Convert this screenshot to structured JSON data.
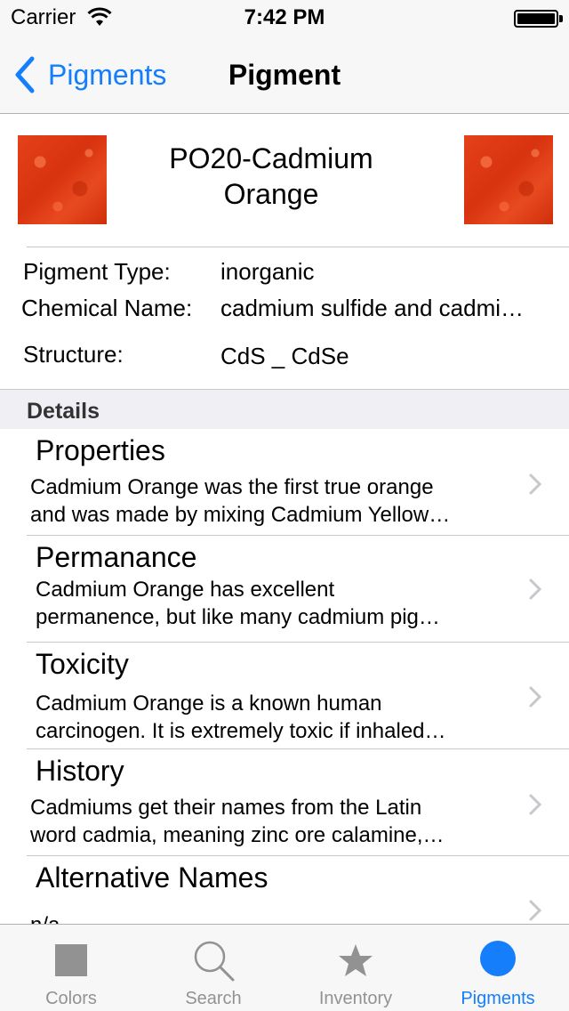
{
  "status_bar": {
    "carrier": "Carrier",
    "time": "7:42 PM"
  },
  "nav": {
    "back_label": "Pigments",
    "title": "Pigment"
  },
  "pigment": {
    "name_line1": "PO20-Cadmium",
    "name_line2": "Orange"
  },
  "info": {
    "type_label": "Pigment Type:",
    "type_value": "inorganic",
    "chem_label": "Chemical Name:",
    "chem_value": "cadmium sulfide and cadmium selenide",
    "structure_label": "Structure:",
    "structure_value": "CdS _ CdSe"
  },
  "section": {
    "title": "Details"
  },
  "details": [
    {
      "title": "Properties",
      "line1": "Cadmium Orange was the first true orange",
      "line2": "and was made by mixing Cadmium Yellow…"
    },
    {
      "title": "Permanance",
      "line1": "Cadmium Orange has excellent",
      "line2": "permanence, but like many cadmium pig…"
    },
    {
      "title": "Toxicity",
      "line1": "Cadmium Orange is a known human",
      "line2": "carcinogen. It is extremely toxic if inhaled…"
    },
    {
      "title": "History",
      "line1": "Cadmiums get their names from the Latin",
      "line2": "word cadmia, meaning zinc ore calamine,…"
    },
    {
      "title": "Alternative Names",
      "line1": "n/a"
    }
  ],
  "tabs": [
    {
      "label": "Colors",
      "icon": "square-icon"
    },
    {
      "label": "Search",
      "icon": "magnifier-icon"
    },
    {
      "label": "Inventory",
      "icon": "star-icon"
    },
    {
      "label": "Pigments",
      "icon": "circle-icon",
      "active": true
    }
  ],
  "colors": {
    "accent": "#147efb",
    "swatch": "#e03c15",
    "inactive": "#929292"
  }
}
